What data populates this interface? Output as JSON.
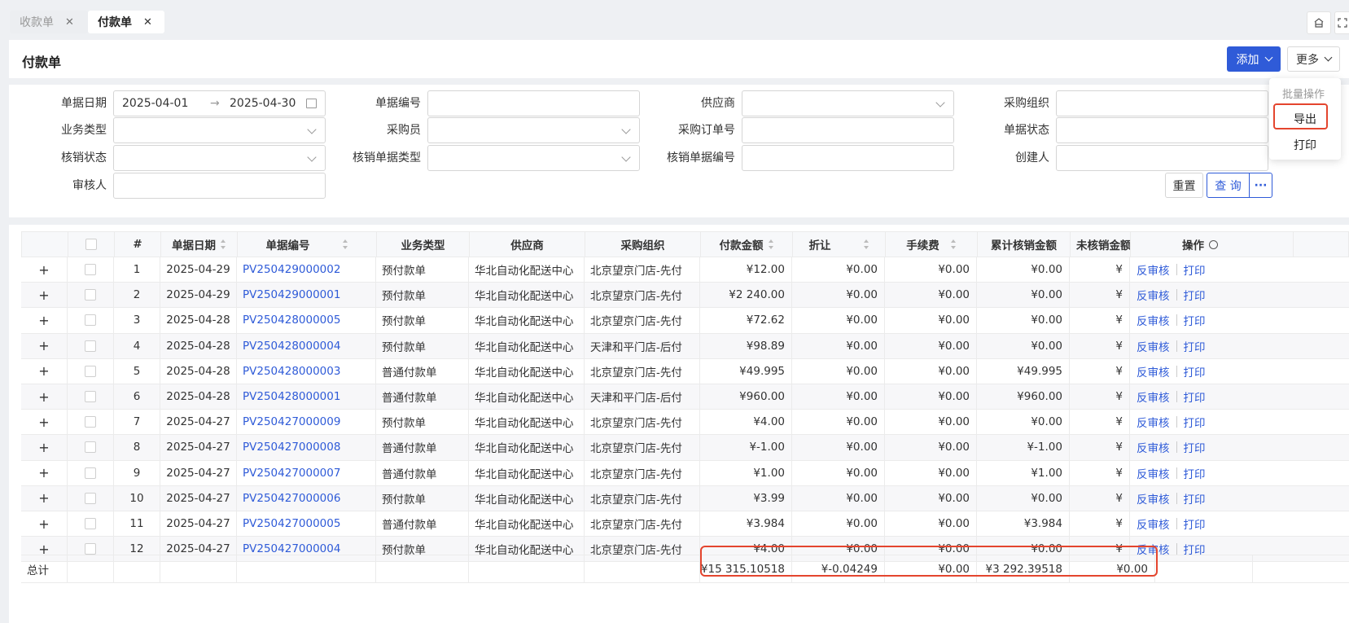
{
  "tabs": [
    {
      "label": "收款单",
      "active": false
    },
    {
      "label": "付款单",
      "active": true
    }
  ],
  "header": {
    "title": "付款单",
    "add_label": "添加",
    "more_label": "更多"
  },
  "filters": {
    "date_label": "单据日期",
    "date_start": "2025-04-01",
    "date_sep": "→",
    "date_end": "2025-04-30",
    "bill_no_label": "单据编号",
    "supplier_label": "供应商",
    "purchase_org_label": "采购组织",
    "biz_type_label": "业务类型",
    "buyer_label": "采购员",
    "po_no_label": "采购订单号",
    "bill_status_label": "单据状态",
    "verify_status_label": "核销状态",
    "verify_bill_type_label": "核销单据类型",
    "verify_bill_no_label": "核销单据编号",
    "creator_label": "创建人",
    "auditor_label": "审核人",
    "reset_label": "重置",
    "query_label": "查 询",
    "query_more": "···"
  },
  "menu": {
    "header": "批量操作",
    "export": "导出",
    "print": "打印"
  },
  "table": {
    "columns": {
      "index": "#",
      "date": "单据日期",
      "bill_no": "单据编号",
      "biz_type": "业务类型",
      "supplier": "供应商",
      "purchase_org": "采购组织",
      "pay_amount": "付款金额",
      "discount": "折让",
      "fee": "手续费",
      "verified": "累计核销金额",
      "unverified": "未核销金额",
      "ops": "操作"
    },
    "row_expand": "+",
    "op_unaudit": "反审核",
    "op_print": "打印",
    "rows": [
      {
        "idx": "1",
        "date": "2025-04-29",
        "no": "PV250429000002",
        "type": "预付款单",
        "supplier": "华北自动化配送中心",
        "org": "北京望京门店-先付",
        "pay": "¥12.00",
        "disc": "¥0.00",
        "fee": "¥0.00",
        "ver": "¥0.00",
        "unver": "¥"
      },
      {
        "idx": "2",
        "date": "2025-04-29",
        "no": "PV250429000001",
        "type": "预付款单",
        "supplier": "华北自动化配送中心",
        "org": "北京望京门店-先付",
        "pay": "¥2 240.00",
        "disc": "¥0.00",
        "fee": "¥0.00",
        "ver": "¥0.00",
        "unver": "¥"
      },
      {
        "idx": "3",
        "date": "2025-04-28",
        "no": "PV250428000005",
        "type": "预付款单",
        "supplier": "华北自动化配送中心",
        "org": "北京望京门店-先付",
        "pay": "¥72.62",
        "disc": "¥0.00",
        "fee": "¥0.00",
        "ver": "¥0.00",
        "unver": "¥"
      },
      {
        "idx": "4",
        "date": "2025-04-28",
        "no": "PV250428000004",
        "type": "预付款单",
        "supplier": "华北自动化配送中心",
        "org": "天津和平门店-后付",
        "pay": "¥98.89",
        "disc": "¥0.00",
        "fee": "¥0.00",
        "ver": "¥0.00",
        "unver": "¥"
      },
      {
        "idx": "5",
        "date": "2025-04-28",
        "no": "PV250428000003",
        "type": "普通付款单",
        "supplier": "华北自动化配送中心",
        "org": "北京望京门店-先付",
        "pay": "¥49.995",
        "disc": "¥0.00",
        "fee": "¥0.00",
        "ver": "¥49.995",
        "unver": "¥"
      },
      {
        "idx": "6",
        "date": "2025-04-28",
        "no": "PV250428000001",
        "type": "普通付款单",
        "supplier": "华北自动化配送中心",
        "org": "天津和平门店-后付",
        "pay": "¥960.00",
        "disc": "¥0.00",
        "fee": "¥0.00",
        "ver": "¥960.00",
        "unver": "¥"
      },
      {
        "idx": "7",
        "date": "2025-04-27",
        "no": "PV250427000009",
        "type": "预付款单",
        "supplier": "华北自动化配送中心",
        "org": "北京望京门店-先付",
        "pay": "¥4.00",
        "disc": "¥0.00",
        "fee": "¥0.00",
        "ver": "¥0.00",
        "unver": "¥"
      },
      {
        "idx": "8",
        "date": "2025-04-27",
        "no": "PV250427000008",
        "type": "普通付款单",
        "supplier": "华北自动化配送中心",
        "org": "北京望京门店-先付",
        "pay": "¥-1.00",
        "disc": "¥0.00",
        "fee": "¥0.00",
        "ver": "¥-1.00",
        "unver": "¥"
      },
      {
        "idx": "9",
        "date": "2025-04-27",
        "no": "PV250427000007",
        "type": "普通付款单",
        "supplier": "华北自动化配送中心",
        "org": "北京望京门店-先付",
        "pay": "¥1.00",
        "disc": "¥0.00",
        "fee": "¥0.00",
        "ver": "¥1.00",
        "unver": "¥"
      },
      {
        "idx": "10",
        "date": "2025-04-27",
        "no": "PV250427000006",
        "type": "预付款单",
        "supplier": "华北自动化配送中心",
        "org": "北京望京门店-先付",
        "pay": "¥3.99",
        "disc": "¥0.00",
        "fee": "¥0.00",
        "ver": "¥0.00",
        "unver": "¥"
      },
      {
        "idx": "11",
        "date": "2025-04-27",
        "no": "PV250427000005",
        "type": "普通付款单",
        "supplier": "华北自动化配送中心",
        "org": "北京望京门店-先付",
        "pay": "¥3.984",
        "disc": "¥0.00",
        "fee": "¥0.00",
        "ver": "¥3.984",
        "unver": "¥"
      },
      {
        "idx": "12",
        "date": "2025-04-27",
        "no": "PV250427000004",
        "type": "预付款单",
        "supplier": "华北自动化配送中心",
        "org": "北京望京门店-先付",
        "pay": "¥4.00",
        "disc": "¥0.00",
        "fee": "¥0.00",
        "ver": "¥0.00",
        "unver": "¥"
      }
    ],
    "totals": {
      "label": "总计",
      "pay": "¥15 315.10518",
      "disc": "¥-0.04249",
      "fee": "¥0.00",
      "ver": "¥3 292.39518",
      "unver": "¥0.00"
    }
  },
  "colors": {
    "primary": "#2f5bd8",
    "highlight": "#e4452e"
  }
}
